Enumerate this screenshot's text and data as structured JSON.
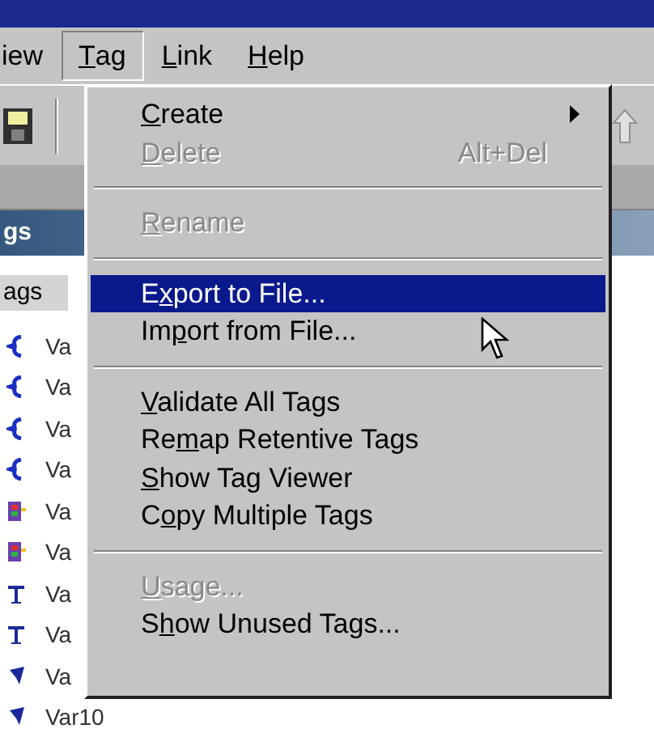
{
  "menubar": [
    {
      "label_parts": {
        "post": "iew"
      },
      "selected": false
    },
    {
      "label_parts": {
        "key": "T",
        "post": "ag"
      },
      "selected": true
    },
    {
      "label_parts": {
        "key": "L",
        "post": "ink"
      },
      "selected": false
    },
    {
      "label_parts": {
        "key": "H",
        "post": "elp"
      },
      "selected": false
    }
  ],
  "panel": {
    "title": "gs",
    "column_header": "ags",
    "rows": [
      {
        "label": "Va",
        "kind": "brace"
      },
      {
        "label": "Va",
        "kind": "brace"
      },
      {
        "label": "Va",
        "kind": "brace"
      },
      {
        "label": "Va",
        "kind": "brace"
      },
      {
        "label": "Va",
        "kind": "block"
      },
      {
        "label": "Va",
        "kind": "block"
      },
      {
        "label": "Va",
        "kind": "t"
      },
      {
        "label": "Va",
        "kind": "t"
      },
      {
        "label": "Va",
        "kind": "arrow"
      },
      {
        "label": "Var10",
        "kind": "arrow"
      }
    ]
  },
  "menu": [
    {
      "kind": "item",
      "label_parts": {
        "key": "C",
        "post": "reate"
      },
      "disabled": false,
      "selected": false,
      "submenu": true
    },
    {
      "kind": "item",
      "label_parts": {
        "key": "D",
        "post": "elete"
      },
      "disabled": true,
      "selected": false,
      "shortcut": "Alt+Del"
    },
    {
      "kind": "separator"
    },
    {
      "kind": "item",
      "label_parts": {
        "key": "R",
        "post": "ename"
      },
      "disabled": true,
      "selected": false
    },
    {
      "kind": "separator"
    },
    {
      "kind": "item",
      "label_parts": {
        "pre": "E",
        "key": "x",
        "post": "port to File..."
      },
      "disabled": false,
      "selected": true
    },
    {
      "kind": "item",
      "label_parts": {
        "pre": "Im",
        "key": "p",
        "post": "ort from File..."
      },
      "disabled": false,
      "selected": false
    },
    {
      "kind": "separator"
    },
    {
      "kind": "item",
      "label_parts": {
        "key": "V",
        "post": "alidate All Tags"
      },
      "disabled": false,
      "selected": false
    },
    {
      "kind": "item",
      "label_parts": {
        "pre": "Re",
        "key": "m",
        "post": "ap Retentive Tags"
      },
      "disabled": false,
      "selected": false
    },
    {
      "kind": "item",
      "label_parts": {
        "key": "S",
        "post": "how Tag Viewer"
      },
      "disabled": false,
      "selected": false
    },
    {
      "kind": "item",
      "label_parts": {
        "pre": "C",
        "key": "o",
        "post": "py Multiple Tags"
      },
      "disabled": false,
      "selected": false
    },
    {
      "kind": "separator"
    },
    {
      "kind": "item",
      "label_parts": {
        "key": "U",
        "post": "sage..."
      },
      "disabled": true,
      "selected": false
    },
    {
      "kind": "item",
      "label_parts": {
        "pre": "S",
        "key": "h",
        "post": "ow Unused Tags..."
      },
      "disabled": false,
      "selected": false
    }
  ]
}
